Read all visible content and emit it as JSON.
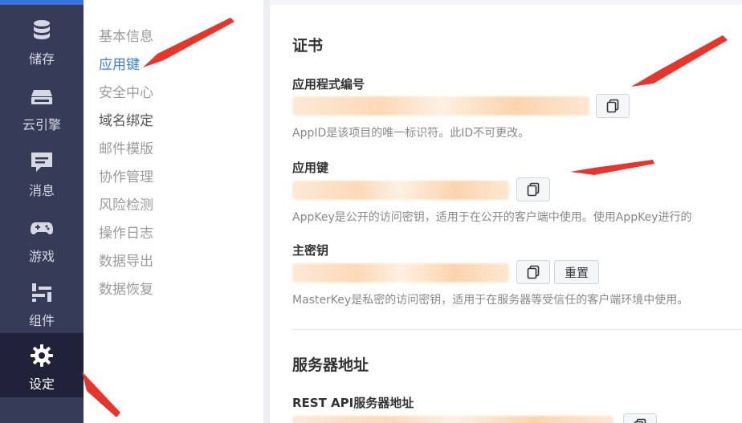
{
  "sidebar": {
    "items": [
      {
        "label": "储存",
        "icon": "database-icon"
      },
      {
        "label": "云引擎",
        "icon": "cloud-engine-icon"
      },
      {
        "label": "消息",
        "icon": "message-icon"
      },
      {
        "label": "游戏",
        "icon": "gamepad-icon"
      },
      {
        "label": "组件",
        "icon": "components-icon"
      },
      {
        "label": "设定",
        "icon": "gear-icon"
      }
    ],
    "active": "设定"
  },
  "submenu": {
    "items": [
      "基本信息",
      "应用键",
      "安全中心",
      "域名绑定",
      "邮件模版",
      "协作管理",
      "风险检测",
      "操作日志",
      "数据导出",
      "数据恢复"
    ],
    "active": "应用键"
  },
  "main": {
    "certificate_title": "证书",
    "app_id": {
      "label": "应用程式编号",
      "help": "AppID是该项目的唯一标识符。此ID不可更改。"
    },
    "app_key": {
      "label": "应用键",
      "help": "AppKey是公开的访问密钥，适用于在公开的客户端中使用。使用AppKey进行的"
    },
    "master_key": {
      "label": "主密钥",
      "help": "MasterKey是私密的访问密钥，适用于在服务器等受信任的客户端环境中使用。",
      "reset_label": "重置"
    },
    "server_title": "服务器地址",
    "rest_api": {
      "label": "REST API服务器地址"
    }
  },
  "colors": {
    "sidebar_bg": "#363b57",
    "sidebar_active_bg": "#1f2238",
    "accent": "#3a74e0",
    "link": "#3b82d6",
    "annotation_arrow": "#e8352b"
  }
}
